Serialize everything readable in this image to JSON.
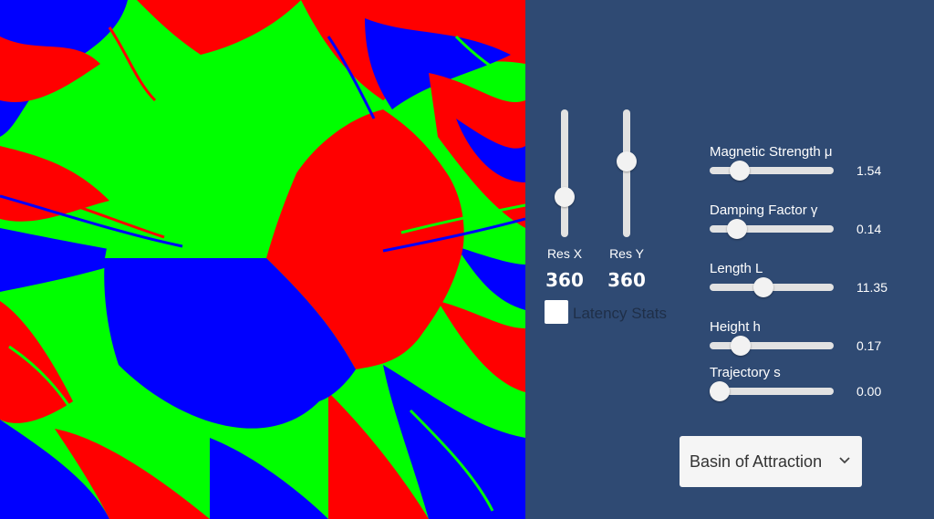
{
  "visualization": {
    "colors": {
      "red": "#ff0000",
      "green": "#00ff00",
      "blue": "#0000ff"
    }
  },
  "resolution": {
    "x": {
      "label": "Res X",
      "value": "360",
      "level": 0.72
    },
    "y": {
      "label": "Res Y",
      "value": "360",
      "level": 0.39
    }
  },
  "latency": {
    "label": "Latency Stats",
    "checked": false
  },
  "params": [
    {
      "label": "Magnetic Strength μ",
      "value": "1.54",
      "level": 0.19
    },
    {
      "label": "Damping Factor γ",
      "value": "0.14",
      "level": 0.17
    },
    {
      "label": "Length L",
      "value": "11.35",
      "level": 0.42
    },
    {
      "label": "Height h",
      "value": "0.17",
      "level": 0.2
    },
    {
      "label": "Trajectory s",
      "value": "0.00",
      "level": 0.0
    }
  ],
  "mode": {
    "selected": "Basin of Attraction",
    "icon": "chevron-down-icon"
  }
}
